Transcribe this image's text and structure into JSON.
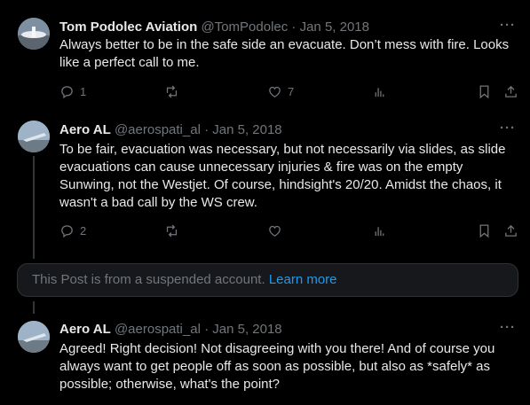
{
  "posts": [
    {
      "name": "Tom Podolec Aviation",
      "handle": "@TomPodolec",
      "sep": "·",
      "date": "Jan 5, 2018",
      "text": "Always better to be in the safe side an evacuate. Don’t mess with fire. Looks like a perfect call to me.",
      "replies": "1",
      "reposts": "",
      "likes": "7"
    },
    {
      "name": "Aero AL",
      "handle": "@aerospati_al",
      "sep": "·",
      "date": "Jan 5, 2018",
      "text": "To be fair, evacuation was necessary, but not necessarily via slides, as slide evacuations can cause unnecessary injuries & fire was on the empty Sunwing, not the Westjet. Of course, hindsight's 20/20. Amidst the chaos, it wasn't a bad call by the WS crew.",
      "replies": "2",
      "reposts": "",
      "likes": ""
    },
    {
      "name": "Aero AL",
      "handle": "@aerospati_al",
      "sep": "·",
      "date": "Jan 5, 2018",
      "text": "Agreed! Right decision! Not disagreeing with you there! And of course you always want to get people off as soon as possible, but also as *safely* as possible; otherwise, what's the point?"
    }
  ],
  "suspended": {
    "text": "This Post is from a suspended account.",
    "link": "Learn more"
  },
  "more_label": "···"
}
